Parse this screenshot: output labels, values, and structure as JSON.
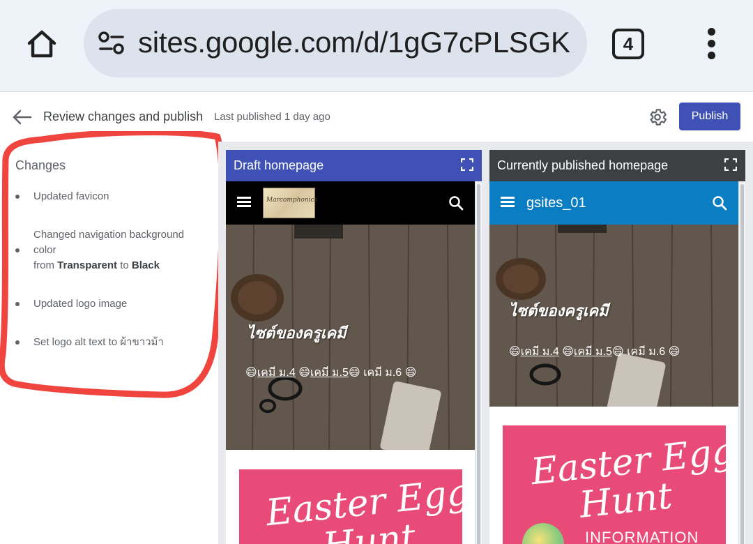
{
  "browser": {
    "url": "sites.google.com/d/1gG7cPLSGK",
    "tab_count": "4"
  },
  "header": {
    "title": "Review changes and publish",
    "last_published": "Last published 1 day ago",
    "publish_label": "Publish"
  },
  "changes": {
    "title": "Changes",
    "items": [
      {
        "text": "Updated favicon"
      },
      {
        "line1": "Changed navigation background",
        "line2": "color",
        "from_word": "from",
        "from_value": "Transparent",
        "to_word": "to",
        "to_value": "Black"
      },
      {
        "text": "Updated logo image"
      },
      {
        "text": "Set logo alt text to ผ้าขาวม้า"
      }
    ]
  },
  "draft": {
    "header": "Draft homepage",
    "header_color": "#3f51b5",
    "nav_color": "#000000",
    "logo_text": "Marcomphonics",
    "hero_title": "ไซต์ของครูเคมี",
    "links": [
      "😄",
      "เคมี ม.4",
      " 😄",
      "เคมี ม.5",
      "😄 เคมี ม.6 😄"
    ],
    "poster_line1": "Easter Egg",
    "poster_line2": "Hunt"
  },
  "published": {
    "header": "Currently published homepage",
    "header_color": "#3c4043",
    "nav_color": "#0b7dc2",
    "site_name": "gsites_01",
    "hero_title": "ไซต์ของครูเคมี",
    "links": [
      "😄",
      "เคมี ม.4",
      " 😄",
      "เคมี ม.5",
      "😄 เคมี ม.6 😄"
    ],
    "poster_line1": "Easter Egg",
    "poster_line2": "Hunt",
    "poster_info": "INFORMATION"
  }
}
